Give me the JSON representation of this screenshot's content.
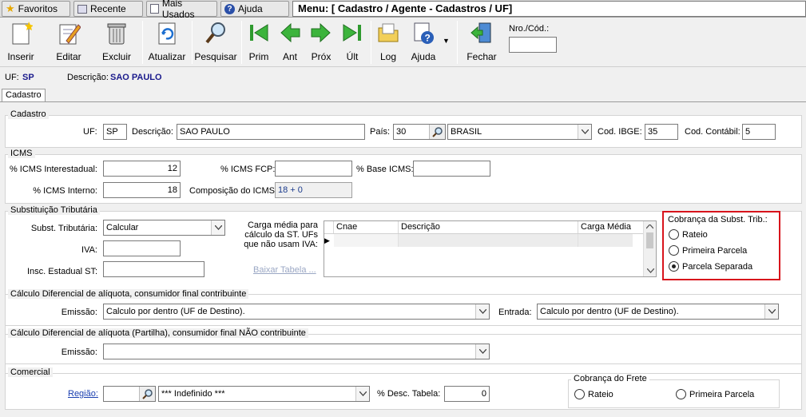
{
  "nav": {
    "tabs": [
      "Favoritos",
      "Recente",
      "Mais Usados",
      "Ajuda"
    ],
    "menu_title": "Menu: [ Cadastro / Agente - Cadastros / UF]"
  },
  "toolbar": {
    "inserir": "Inserir",
    "editar": "Editar",
    "excluir": "Excluir",
    "atualizar": "Atualizar",
    "pesquisar": "Pesquisar",
    "prim": "Prim",
    "ant": "Ant",
    "prox": "Próx",
    "ult": "Últ",
    "log": "Log",
    "ajuda": "Ajuda",
    "fechar": "Fechar",
    "nro_label": "Nro./Cód.:",
    "nro_value": ""
  },
  "info": {
    "uf_label": "UF:",
    "uf_value": "SP",
    "desc_label": "Descrição:",
    "desc_value": "SAO PAULO"
  },
  "tab": "Cadastro",
  "cadastro": {
    "title": "Cadastro",
    "uf_label": "UF:",
    "uf_value": "SP",
    "desc_label": "Descrição:",
    "desc_value": "SAO PAULO",
    "pais_label": "País:",
    "pais_code": "30",
    "pais_name": "BRASIL",
    "ibge_label": "Cod. IBGE:",
    "ibge_value": "35",
    "contabil_label": "Cod. Contábil:",
    "contabil_value": "5"
  },
  "icms": {
    "title": "ICMS",
    "inter_label": "% ICMS Interestadual:",
    "inter_value": "12",
    "fcp_label": "% ICMS FCP:",
    "fcp_value": "",
    "base_label": "% Base ICMS:",
    "base_value": "",
    "interno_label": "% ICMS Interno:",
    "interno_value": "18",
    "comp_label": "Composição do ICMS:",
    "comp_value": "18 + 0"
  },
  "st": {
    "title": "Substituição Tributária",
    "subst_label": "Subst. Tributária:",
    "subst_value": "Calcular",
    "iva_label": "IVA:",
    "iva_value": "",
    "insc_label": "Insc. Estadual ST:",
    "insc_value": "",
    "carga_label": "Carga média para cálculo da ST. UFs que não usam IVA:",
    "baixar": "Baixar Tabela ...",
    "grid_headers": [
      "Cnae",
      "Descrição",
      "Carga Média"
    ],
    "cobranca_title": "Cobrança da Subst. Trib.:",
    "cobranca_options": [
      "Rateio",
      "Primeira Parcela",
      "Parcela Separada"
    ],
    "cobranca_selected": "Parcela Separada",
    "highlight_color": "#d8141c"
  },
  "difal1": {
    "title": "Cálculo Diferencial de alíquota, consumidor final contribuinte",
    "emissao_label": "Emissão:",
    "emissao_value": "Calculo por dentro (UF de Destino).",
    "entrada_label": "Entrada:",
    "entrada_value": "Calculo por dentro (UF de Destino)."
  },
  "difal2": {
    "title": "Cálculo Diferencial de alíquota (Partilha), consumidor final NÃO contribuinte",
    "emissao_label": "Emissão:",
    "emissao_value": ""
  },
  "comercial": {
    "title": "Comercial",
    "regiao_label": "Região:",
    "regiao_code": "",
    "regiao_value": "*** Indefinido ***",
    "desc_label": "% Desc. Tabela:",
    "desc_value": "0",
    "frete_title": "Cobrança do Frete",
    "frete_options": [
      "Rateio",
      "Primeira Parcela"
    ]
  }
}
